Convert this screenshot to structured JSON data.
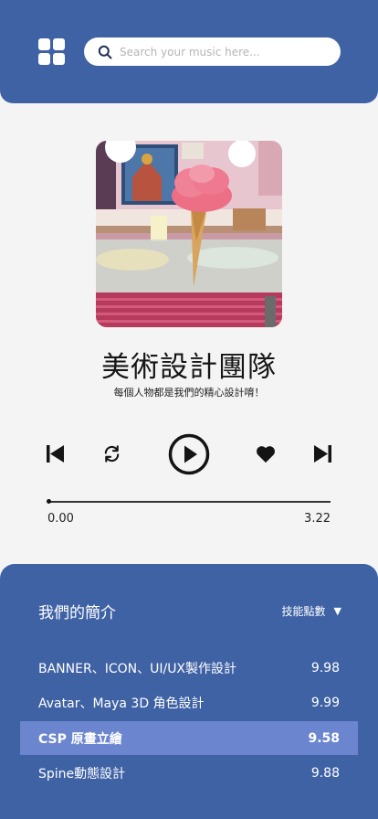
{
  "header": {
    "menu_icon": "grid-icon",
    "search_icon": "search-icon",
    "search_placeholder": "Search your music here..."
  },
  "album": {
    "title": "美術設計團隊",
    "subtitle": "每個人物都是我們的精心設計唷！"
  },
  "controls": {
    "previous_icon": "skip-previous-icon",
    "repeat_icon": "repeat-icon",
    "play_icon": "play-icon",
    "like_icon": "heart-icon",
    "next_icon": "skip-next-icon"
  },
  "progress": {
    "current_time": "0.00",
    "total_time": "3.22",
    "fraction": 0
  },
  "intro": {
    "title": "我們的簡介",
    "sort_label": "技能點數",
    "sort_icon": "caret-down-icon",
    "items": [
      {
        "name": "BANNER、ICON、UI/UX製作設計",
        "score": "9.98",
        "active": false
      },
      {
        "name": "Avatar、Maya 3D 角色設計",
        "score": "9.99",
        "active": false
      },
      {
        "name": "CSP 原畫立繪",
        "score": "9.58",
        "active": true
      },
      {
        "name": "Spine動態設計",
        "score": "9.88",
        "active": false
      }
    ]
  },
  "colors": {
    "primary": "#3f62a5",
    "highlight_row": "#6b86cf",
    "background": "#f4f4f4"
  }
}
